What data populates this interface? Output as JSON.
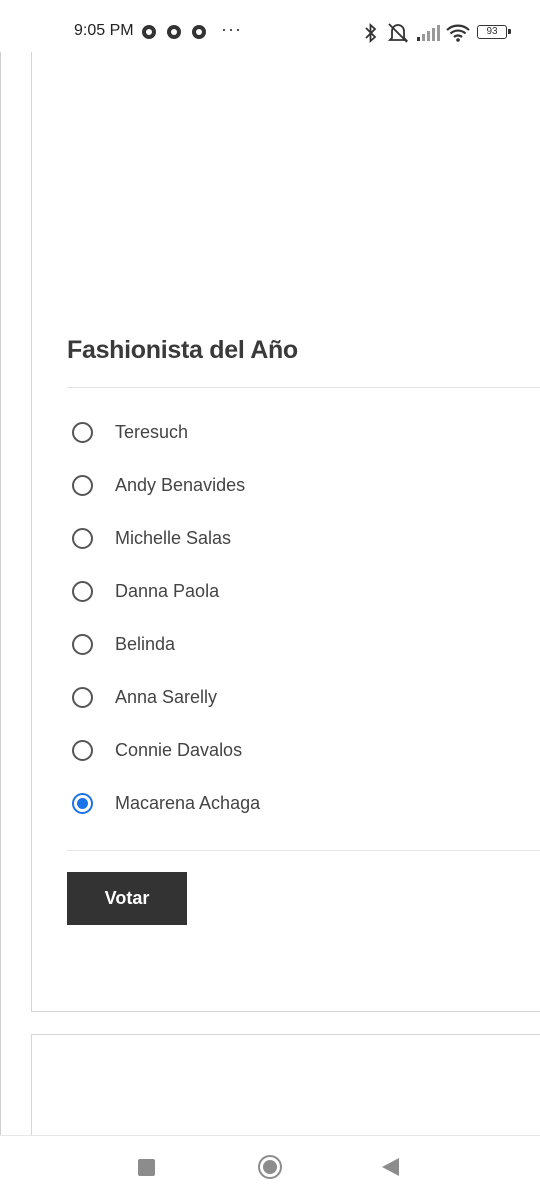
{
  "status_bar": {
    "time": "9:05 PM",
    "battery": "93",
    "icons": [
      "chrome-icon",
      "chrome-icon",
      "chrome-icon",
      "more-icon",
      "bluetooth-icon",
      "vibrate-icon",
      "signal-icon",
      "wifi-icon",
      "battery-icon"
    ]
  },
  "poll": {
    "title": "Fashionista del Año",
    "options": [
      {
        "label": "Teresuch",
        "checked": false
      },
      {
        "label": "Andy Benavides",
        "checked": false
      },
      {
        "label": "Michelle Salas",
        "checked": false
      },
      {
        "label": "Danna Paola",
        "checked": false
      },
      {
        "label": "Belinda",
        "checked": false
      },
      {
        "label": "Anna Sarelly",
        "checked": false
      },
      {
        "label": "Connie Davalos",
        "checked": false
      },
      {
        "label": "Macarena Achaga",
        "checked": true
      }
    ],
    "vote_label": "Votar"
  },
  "colors": {
    "accent": "#1a73e8",
    "button_bg": "#333333"
  },
  "nav_bar": {
    "icons": [
      "recents-icon",
      "home-icon",
      "back-icon"
    ]
  }
}
